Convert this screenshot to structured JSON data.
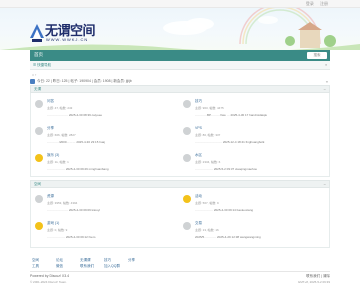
{
  "topbar": {
    "links": [
      "登录",
      "注册"
    ]
  },
  "brand": {
    "name": "无谓空间",
    "domain": "WWW.WWKJ.CN"
  },
  "nav": {
    "home_label": "首页",
    "search_placeholder": "搜索"
  },
  "subbar": {
    "left": "☰ 快捷导航",
    "right": "≡"
  },
  "breadcrumb": "⌂ ›",
  "stats": {
    "text": "今日: 22 | 昨日: 125 | 帖子: 190904 | 会员: 1908 | 新会员: jijijb",
    "toggle": "»"
  },
  "sections": [
    {
      "title": "无谓",
      "forums": [
        {
          "name": "问答",
          "stat": "主题: 47, 帖数: 243",
          "last": "………………… 2025-4-30 08:39 caiyoee",
          "icon": "forum-icon"
        },
        {
          "name": "技巧",
          "stat": "主题: 963, 帖数: 4475",
          "last": "…………BP………Vwe … 2025-4-30 17 handmidaiqiu",
          "icon": "forum-icon"
        },
        {
          "name": "分享",
          "stat": "主题: 666, 帖数: 2827",
          "last": "…………/2000……… 2025-4-30 23:15 huaj",
          "icon": "forum-icon"
        },
        {
          "name": "VPS",
          "stat": "主题: 80, 帖数: 337",
          "last": "……………………… 2025-12-4 18:41 finghuangbolk",
          "icon": "forum-icon"
        },
        {
          "name": "娱乐 (3)",
          "stat": "主题: 1k, 帖数: 1",
          "last": "……………… 2025-4-30 09:29 minghuanbang",
          "icon": "forum-new-icon"
        },
        {
          "name": "水区",
          "stat": "主题: 2334, 帖数: 6",
          "last": "……………… 2025-5-2 09:37 xiaoqingmaohou",
          "icon": "forum-icon"
        }
      ]
    },
    {
      "title": "空间",
      "forums": [
        {
          "name": "资源",
          "stat": "主题: 3953, 帖数: 4394",
          "last": "………………… 2025-4-30 09:09 kiiouyi",
          "icon": "forum-icon"
        },
        {
          "name": "活动",
          "stat": "主题: 567, 帖数: 9",
          "last": "……………… 2025-4-30 09:14 baotuoxiang",
          "icon": "forum-new-icon"
        },
        {
          "name": "游戏 (1)",
          "stat": "主题: 0, 帖数: 9",
          "last": "……………… 2025-4-30 09:12 hiero",
          "icon": "forum-new-icon"
        },
        {
          "name": "交易",
          "stat": "主题: 13, 帖数: 16",
          "last": "2025/5………… 2025-4-29 12:38 wangwangming",
          "icon": "forum-icon"
        }
      ]
    }
  ],
  "footer": {
    "links": [
      "空间",
      "论坛",
      "无谓谓",
      "技巧",
      "分享",
      "工具",
      "微信",
      "联系我们",
      "加入QQ群"
    ],
    "powered": "Powered by Discuz! X3.4",
    "powered_right": "联系我们 | 清除",
    "copyright": "© 2001-2024 Discuz! Team.",
    "runtime": "GMT+8, 2025-5-2 09:39"
  }
}
